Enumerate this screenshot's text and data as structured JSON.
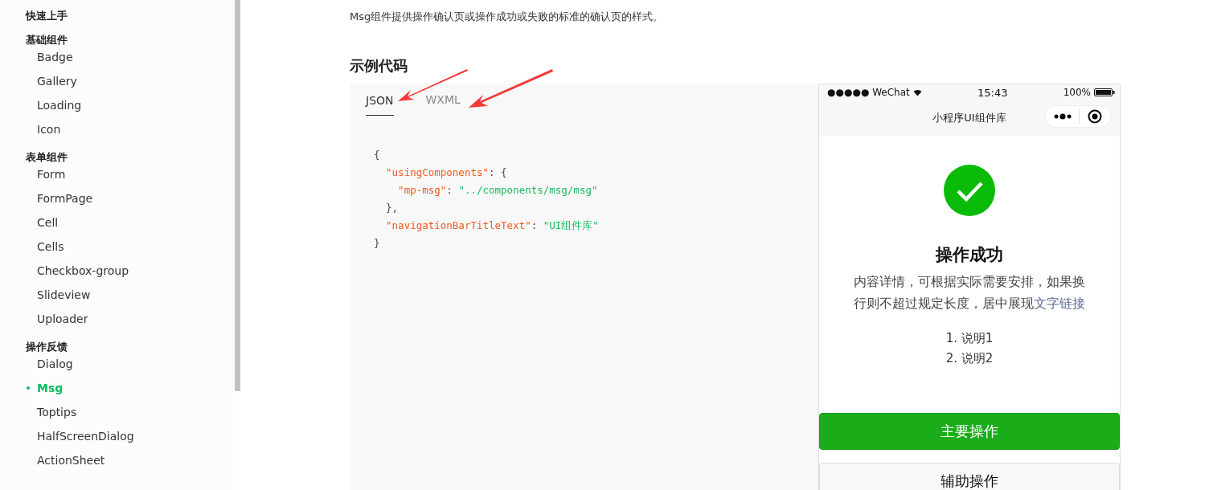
{
  "sidebar": {
    "groups": [
      {
        "title": "快速上手"
      },
      {
        "title": "基础组件",
        "items": [
          {
            "label": "Badge",
            "selected": false
          },
          {
            "label": "Gallery",
            "selected": false
          },
          {
            "label": "Loading",
            "selected": false
          },
          {
            "label": "Icon",
            "selected": false
          }
        ]
      },
      {
        "title": "表单组件",
        "items": [
          {
            "label": "Form",
            "selected": false
          },
          {
            "label": "FormPage",
            "selected": false
          },
          {
            "label": "Cell",
            "selected": false
          },
          {
            "label": "Cells",
            "selected": false
          },
          {
            "label": "Checkbox-group",
            "selected": false
          },
          {
            "label": "Slideview",
            "selected": false
          },
          {
            "label": "Uploader",
            "selected": false
          }
        ]
      },
      {
        "title": "操作反馈",
        "items": [
          {
            "label": "Dialog",
            "selected": false
          },
          {
            "label": "Msg",
            "selected": true
          },
          {
            "label": "Toptips",
            "selected": false
          },
          {
            "label": "HalfScreenDialog",
            "selected": false
          },
          {
            "label": "ActionSheet",
            "selected": false
          }
        ]
      }
    ]
  },
  "intro": "Msg组件提供操作确认页或操作成功或失败的标准的确认页的样式。",
  "section_title": "示例代码",
  "code_tabs": [
    {
      "label": "JSON",
      "selected": true
    },
    {
      "label": "WXML",
      "selected": false
    }
  ],
  "code_lines": [
    [
      {
        "kind": "punct",
        "text": "{"
      }
    ],
    [
      {
        "kind": "key",
        "text": "  \"usingComponents\""
      },
      {
        "kind": "punct",
        "text": ": {"
      }
    ],
    [
      {
        "kind": "key",
        "text": "    \"mp-msg\""
      },
      {
        "kind": "punct",
        "text": ": "
      },
      {
        "kind": "string",
        "text": "\"../components/msg/msg\""
      }
    ],
    [
      {
        "kind": "punct",
        "text": "  },"
      }
    ],
    [
      {
        "kind": "key",
        "text": "  \"navigationBarTitleText\""
      },
      {
        "kind": "punct",
        "text": ": "
      },
      {
        "kind": "string",
        "text": "\"UI组件库\""
      }
    ],
    [
      {
        "kind": "punct",
        "text": "}"
      }
    ]
  ],
  "phone": {
    "status_bar": {
      "carrier": "●●●●● WeChat",
      "time": "15:43",
      "battery": "100%"
    },
    "nav_title": "小程序UI组件库",
    "msg": {
      "title": "操作成功",
      "description": "内容详情，可根据实际需要安排，如果换行则不超过规定长度，居中展现",
      "link": "文字链接",
      "notes": [
        "1. 说明1",
        "2. 说明2"
      ]
    },
    "buttons": [
      {
        "label": "主要操作",
        "kind": "primary"
      },
      {
        "label": "辅助操作",
        "kind": "default"
      }
    ]
  }
}
